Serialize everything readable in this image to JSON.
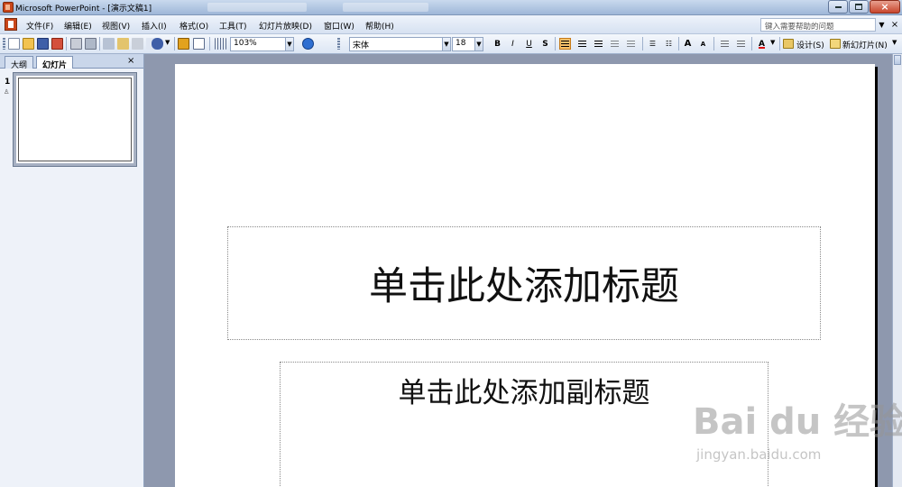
{
  "window": {
    "title": "Microsoft PowerPoint - [演示文稿1]"
  },
  "menu": {
    "items": [
      "文件(F)",
      "编辑(E)",
      "视图(V)",
      "插入(I)",
      "格式(O)",
      "工具(T)",
      "幻灯片放映(D)",
      "窗口(W)",
      "帮助(H)"
    ]
  },
  "help": {
    "placeholder": "键入需要帮助的问题"
  },
  "toolbar": {
    "zoom": "103%",
    "font": "宋体",
    "font_size": "18",
    "bold": "B",
    "italic": "I",
    "underline": "U",
    "shadow": "S",
    "grow_font": "A",
    "shrink_font": "A",
    "font_color": "A",
    "design_label": "设计(S)",
    "new_slide_label": "新幻灯片(N)"
  },
  "pane": {
    "tab_outline": "大纲",
    "tab_slides": "幻灯片",
    "close": "×",
    "slide_number": "1"
  },
  "slide": {
    "title_placeholder": "单击此处添加标题",
    "subtitle_placeholder": "单击此处添加副标题"
  },
  "watermark": {
    "main": "Bai du 经验",
    "sub": "jingyan.baidu.com"
  }
}
